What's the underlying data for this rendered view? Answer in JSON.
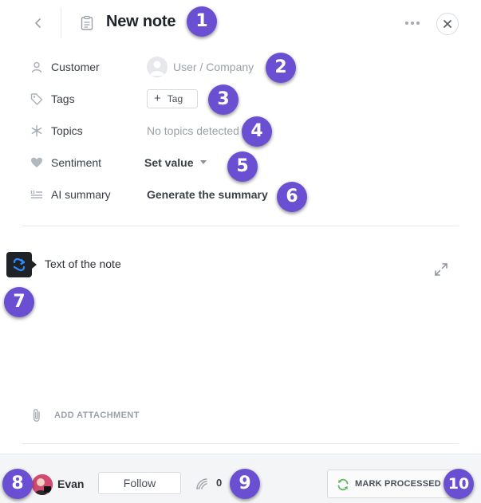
{
  "header": {
    "title": "New note",
    "back_icon": "chevron-left-icon",
    "note_icon": "clipboard-icon",
    "more_icon": "ellipsis-icon",
    "close_icon": "close-icon"
  },
  "properties": {
    "customer": {
      "label": "Customer",
      "placeholder": "User / Company",
      "icon": "person-icon"
    },
    "tags": {
      "label": "Tags",
      "button_label": "Tag",
      "icon": "tag-icon"
    },
    "topics": {
      "label": "Topics",
      "value": "No topics detected",
      "icon": "snowflake-icon"
    },
    "sentiment": {
      "label": "Sentiment",
      "value": "Set value",
      "icon": "heart-icon"
    },
    "ai_summary": {
      "label": "AI summary",
      "button_label": "Generate the summary",
      "icon": "summary-lines-icon"
    }
  },
  "editor": {
    "text": "Text of the note",
    "ai_icon": "ai-assistant-icon",
    "expand_icon": "expand-icon"
  },
  "attachment": {
    "label": "ADD ATTACHMENT",
    "icon": "paperclip-icon"
  },
  "footer": {
    "user_name": "Evan",
    "follow_label": "Follow",
    "signal_count": "0",
    "signal_icon": "signal-icon",
    "mark_processed_label": "MARK PROCESSED",
    "mark_icon": "refresh-icon"
  },
  "callouts": [
    "1",
    "2",
    "3",
    "4",
    "5",
    "6",
    "7",
    "8",
    "9",
    "10"
  ],
  "colors": {
    "callout": "#6b4fd3",
    "accent_blue": "#2f8cff",
    "processed_green": "#5cb85c"
  }
}
